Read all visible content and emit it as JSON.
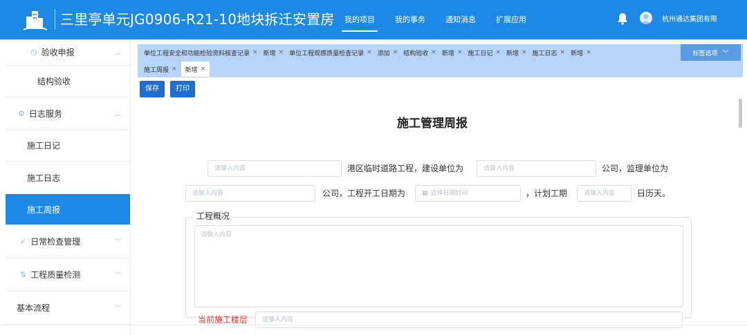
{
  "header": {
    "title": "三里亭单元JG0906-R21-10地块拆迁安置房",
    "nav": [
      "我的项目",
      "我的事务",
      "通知消息",
      "扩展应用"
    ],
    "active_nav": 0,
    "company": "杭州通达集团有限",
    "icons": {
      "logo": "building-logo",
      "bell": "bell-icon",
      "avatar": "user-avatar-icon"
    }
  },
  "sidebar": {
    "items": [
      {
        "label": "验收申报",
        "icon": "clock-icon",
        "chevron": "up"
      },
      {
        "label": "结构验收"
      },
      {
        "label": "日志服务",
        "icon": "gear-icon",
        "chevron": "up"
      },
      {
        "label": "施工日记"
      },
      {
        "label": "施工日志"
      },
      {
        "label": "施工周报",
        "active": true
      },
      {
        "label": "日常检查管理",
        "icon": "check-icon",
        "chevron": "down"
      },
      {
        "label": "工程质量检测",
        "icon": "sort-icon",
        "chevron": "down"
      },
      {
        "label": "基本流程",
        "chevron": "down"
      }
    ]
  },
  "tabs": {
    "row1": [
      "单位工程安全和功能检验资料核查记录",
      "新增",
      "单位工程观感质量检查记录",
      "添加",
      "结构验收",
      "新增",
      "施工日记",
      "新增",
      "施工日志",
      "新增"
    ],
    "row2": [
      "施工周报",
      "新增"
    ],
    "active": "新增",
    "options_label": "标签选项"
  },
  "actions": {
    "save": "保存",
    "print": "打印"
  },
  "form": {
    "title": "施工管理周报",
    "placeholder": "请输入内容",
    "date_placeholder": "选择日期时间",
    "text1": "港区临时道路工程，建设单位为",
    "text2": "公司，监理单位为",
    "text3": "公司，工程开工日期为",
    "text4": "，计划工期",
    "text5": "日历天。",
    "overview_label": "工程概况",
    "current_floor_label": "当前施工楼层"
  },
  "colors": {
    "primary": "#1e88e5",
    "tabbar": "#b6d4f8",
    "button": "#1e6fd0",
    "danger": "#e53935"
  }
}
